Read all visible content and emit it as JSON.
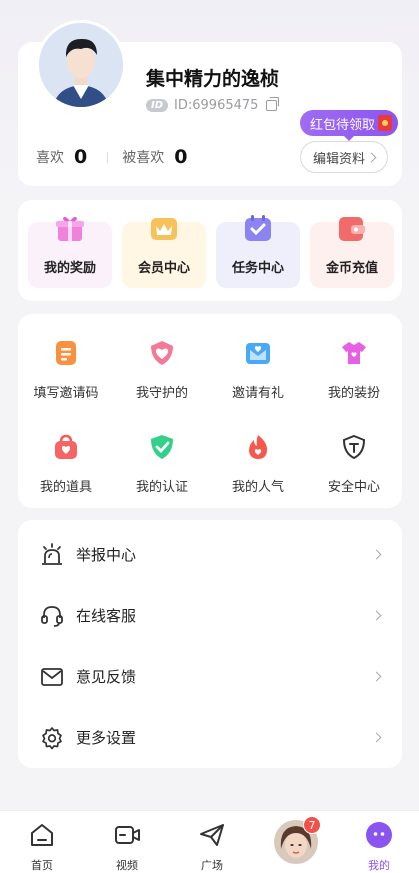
{
  "profile": {
    "nickname": "集中精力的逸桢",
    "id_chip": "ID",
    "uid": "ID:69965475",
    "likes_label": "喜欢",
    "likes_value": "0",
    "liked_by_label": "被喜欢",
    "liked_by_value": "0",
    "redpack_label": "红包待领取",
    "edit_label": "编辑资料"
  },
  "quick": [
    {
      "label": "我的奖励",
      "icon": "gift-icon",
      "bg": "#fbf1fb",
      "color": "#e66bd6"
    },
    {
      "label": "会员中心",
      "icon": "crown-icon",
      "bg": "#fff6e4",
      "color": "#f6b43b"
    },
    {
      "label": "任务中心",
      "icon": "calendar-check-icon",
      "bg": "#efeffc",
      "color": "#8a82f0"
    },
    {
      "label": "金币充值",
      "icon": "wallet-icon",
      "bg": "#fdf0ef",
      "color": "#f07070"
    }
  ],
  "grid": [
    {
      "label": "填写邀请码",
      "icon": "clipboard-icon",
      "color": "#f98b3c"
    },
    {
      "label": "我守护的",
      "icon": "heart-shield-icon",
      "color": "#f46b8e"
    },
    {
      "label": "邀请有礼",
      "icon": "envelope-icon",
      "color": "#46a7f5"
    },
    {
      "label": "我的装扮",
      "icon": "shirt-icon",
      "color": "#e15fe0"
    },
    {
      "label": "我的道具",
      "icon": "bag-icon",
      "color": "#f55b5b"
    },
    {
      "label": "我的认证",
      "icon": "verified-shield-icon",
      "color": "#2fcf86"
    },
    {
      "label": "我的人气",
      "icon": "flame-icon",
      "color": "#f55a4c"
    },
    {
      "label": "安全中心",
      "icon": "security-shield-icon",
      "color": "#333333"
    }
  ],
  "list": [
    {
      "label": "举报中心",
      "icon": "alarm-icon"
    },
    {
      "label": "在线客服",
      "icon": "headset-icon"
    },
    {
      "label": "意见反馈",
      "icon": "mail-icon"
    },
    {
      "label": "更多设置",
      "icon": "gear-icon"
    }
  ],
  "tabs": [
    {
      "label": "首页",
      "icon": "home-icon"
    },
    {
      "label": "视频",
      "icon": "video-icon"
    },
    {
      "label": "广场",
      "icon": "paper-plane-icon"
    },
    {
      "label": "",
      "icon": "avatar"
    },
    {
      "label": "我的",
      "icon": "profile-face-icon"
    }
  ],
  "tab_badge": "7",
  "colors": {
    "accent": "#8a55ef",
    "active_tab": "#8a55ef"
  }
}
